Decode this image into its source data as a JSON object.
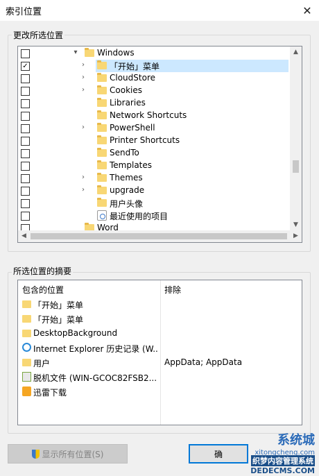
{
  "window": {
    "title": "索引位置",
    "close_icon": "close-icon"
  },
  "change_group": {
    "label": "更改所选位置"
  },
  "tree": [
    {
      "label": "Windows",
      "checked": false,
      "expander": "▾",
      "level": 0,
      "icon": "folder-icon"
    },
    {
      "label": "「开始」菜单",
      "checked": true,
      "expander": "›",
      "level": 1,
      "icon": "folder-icon",
      "selected": true
    },
    {
      "label": "CloudStore",
      "checked": false,
      "expander": "›",
      "level": 1,
      "icon": "folder-icon"
    },
    {
      "label": "Cookies",
      "checked": false,
      "expander": "›",
      "level": 1,
      "icon": "folder-icon"
    },
    {
      "label": "Libraries",
      "checked": false,
      "expander": "",
      "level": 1,
      "icon": "folder-icon"
    },
    {
      "label": "Network Shortcuts",
      "checked": false,
      "expander": "",
      "level": 1,
      "icon": "folder-icon"
    },
    {
      "label": "PowerShell",
      "checked": false,
      "expander": "›",
      "level": 1,
      "icon": "folder-icon"
    },
    {
      "label": "Printer Shortcuts",
      "checked": false,
      "expander": "",
      "level": 1,
      "icon": "folder-icon"
    },
    {
      "label": "SendTo",
      "checked": false,
      "expander": "",
      "level": 1,
      "icon": "folder-icon"
    },
    {
      "label": "Templates",
      "checked": false,
      "expander": "",
      "level": 1,
      "icon": "folder-icon"
    },
    {
      "label": "Themes",
      "checked": false,
      "expander": "›",
      "level": 1,
      "icon": "folder-icon"
    },
    {
      "label": "upgrade",
      "checked": false,
      "expander": "›",
      "level": 1,
      "icon": "folder-icon"
    },
    {
      "label": "用户头像",
      "checked": false,
      "expander": "",
      "level": 1,
      "icon": "folder-icon"
    },
    {
      "label": "最近使用的项目",
      "checked": false,
      "expander": "",
      "level": 1,
      "icon": "recent-items-icon"
    },
    {
      "label": "Word",
      "checked": false,
      "expander": "",
      "level": 0,
      "icon": "folder-icon"
    }
  ],
  "summary_group": {
    "label": "所选位置的摘要"
  },
  "summary": {
    "col_location": "包含的位置",
    "col_exclude": "排除",
    "rows": [
      {
        "location": "「开始」菜单",
        "exclude": "",
        "icon": "folder-icon"
      },
      {
        "location": "「开始」菜单",
        "exclude": "",
        "icon": "folder-icon"
      },
      {
        "location": "DesktopBackground",
        "exclude": "",
        "icon": "folder-icon"
      },
      {
        "location": "Internet Explorer 历史记录 (W...",
        "exclude": "",
        "icon": "ie-icon"
      },
      {
        "location": "用户",
        "exclude": "AppData; AppData",
        "icon": "folder-icon"
      },
      {
        "location": "脱机文件 (WIN-GCOC82FSB2...",
        "exclude": "",
        "icon": "offline-files-icon"
      },
      {
        "location": "迅雷下载",
        "exclude": "",
        "icon": "thunder-icon"
      }
    ]
  },
  "buttons": {
    "show_all": "显示所有位置(S)",
    "ok": "确"
  },
  "watermark": {
    "line1": "系统城",
    "line2": "xitongcheng.com",
    "line3": "织梦内容管理系统",
    "line4": "DEDECMS.COM"
  }
}
